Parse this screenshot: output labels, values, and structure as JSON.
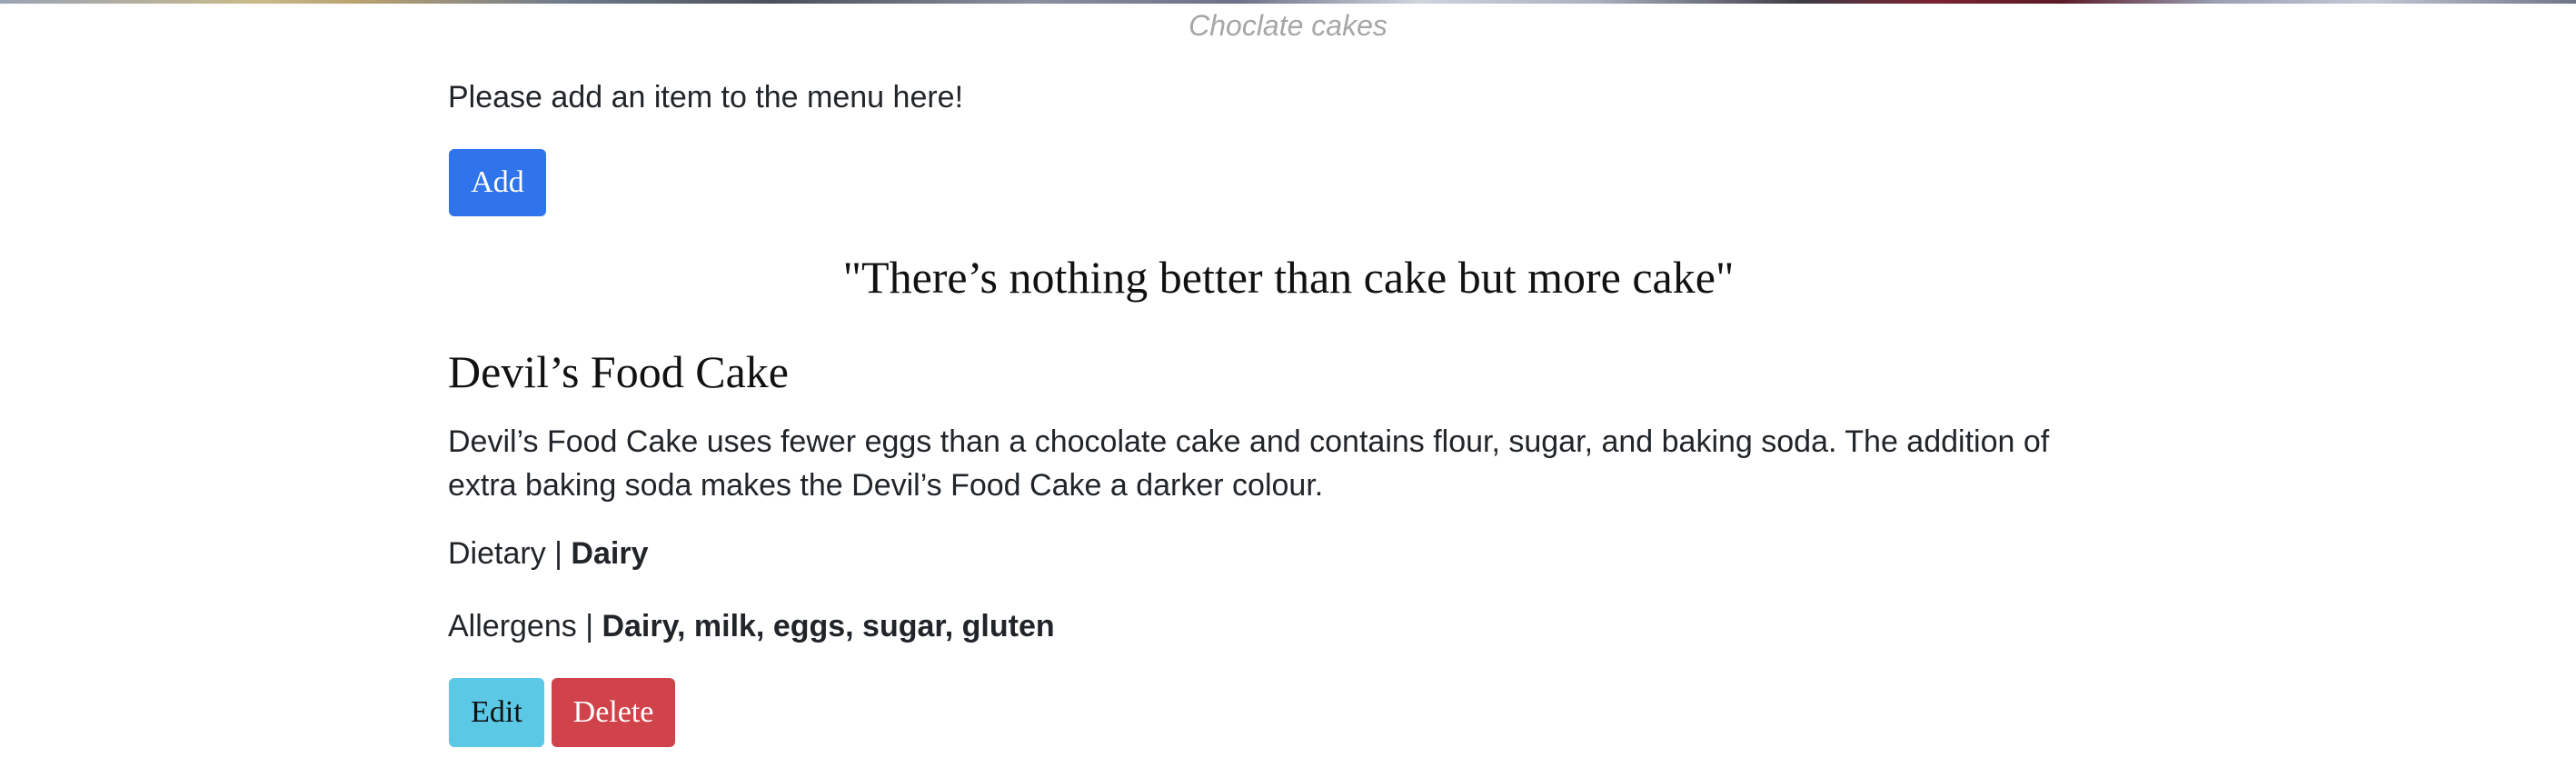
{
  "hero": {
    "caption": "Choclate cakes"
  },
  "form": {
    "intro_text": "Please add an item to the menu here!",
    "add_label": "Add"
  },
  "quote": "\"There’s nothing better than cake but more cake\"",
  "item": {
    "title": "Devil’s Food Cake",
    "description": "Devil’s Food Cake uses fewer eggs than a chocolate cake and contains flour, sugar, and baking soda. The addition of extra baking soda makes the Devil’s Food Cake a darker colour.",
    "dietary_label": "Dietary | ",
    "dietary_value": "Dairy",
    "allergens_label": "Allergens | ",
    "allergens_value": "Dairy, milk, eggs, sugar, gluten",
    "edit_label": "Edit",
    "delete_label": "Delete"
  },
  "colors": {
    "primary": "#2f74ea",
    "info": "#5bc8e6",
    "danger": "#d1434b",
    "caption": "#a6a6a6"
  }
}
